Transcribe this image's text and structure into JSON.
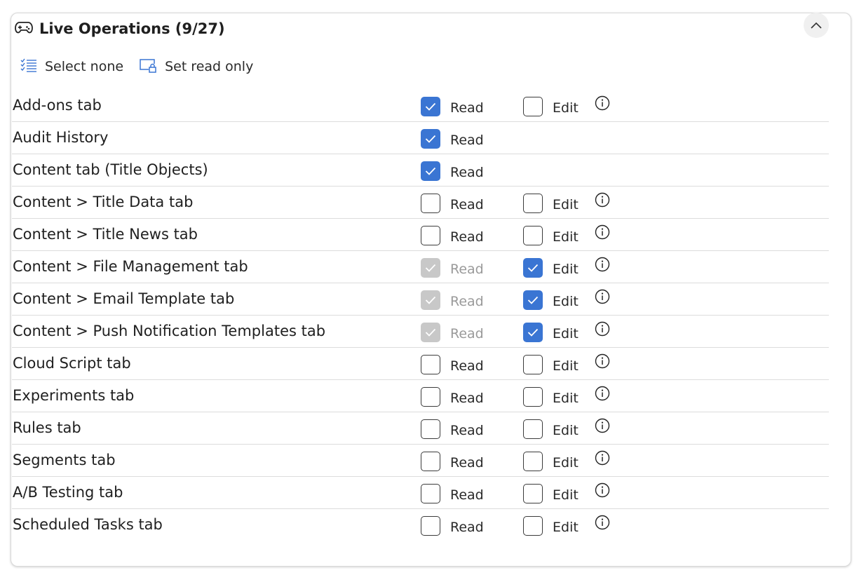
{
  "header": {
    "title": "Live Operations (9/27)",
    "icon": "gamepad-icon"
  },
  "toolbar": {
    "select_none": "Select none",
    "set_read_only": "Set read only"
  },
  "colors": {
    "accent": "#3a75d3",
    "disabled": "#c8c8c8"
  },
  "rows": [
    {
      "name": "Add-ons tab",
      "read": "checked",
      "edit": "unchecked",
      "read_label": "Read",
      "edit_label": "Edit"
    },
    {
      "name": "Audit History",
      "read": "checked",
      "edit": null,
      "read_label": "Read"
    },
    {
      "name": "Content tab (Title Objects)",
      "read": "checked",
      "edit": null,
      "read_label": "Read"
    },
    {
      "name": "Content > Title Data tab",
      "read": "unchecked",
      "edit": "unchecked",
      "read_label": "Read",
      "edit_label": "Edit"
    },
    {
      "name": "Content > Title News tab",
      "read": "unchecked",
      "edit": "unchecked",
      "read_label": "Read",
      "edit_label": "Edit"
    },
    {
      "name": "Content > File Management tab",
      "read": "disabled",
      "edit": "checked",
      "read_label": "Read",
      "edit_label": "Edit"
    },
    {
      "name": "Content > Email Template tab",
      "read": "disabled",
      "edit": "checked",
      "read_label": "Read",
      "edit_label": "Edit"
    },
    {
      "name": "Content > Push Notification Templates tab",
      "read": "disabled",
      "edit": "checked",
      "read_label": "Read",
      "edit_label": "Edit"
    },
    {
      "name": "Cloud Script tab",
      "read": "unchecked",
      "edit": "unchecked",
      "read_label": "Read",
      "edit_label": "Edit"
    },
    {
      "name": "Experiments tab",
      "read": "unchecked",
      "edit": "unchecked",
      "read_label": "Read",
      "edit_label": "Edit"
    },
    {
      "name": "Rules tab",
      "read": "unchecked",
      "edit": "unchecked",
      "read_label": "Read",
      "edit_label": "Edit"
    },
    {
      "name": "Segments tab",
      "read": "unchecked",
      "edit": "unchecked",
      "read_label": "Read",
      "edit_label": "Edit"
    },
    {
      "name": "A/B Testing tab",
      "read": "unchecked",
      "edit": "unchecked",
      "read_label": "Read",
      "edit_label": "Edit"
    },
    {
      "name": "Scheduled Tasks tab",
      "read": "unchecked",
      "edit": "unchecked",
      "read_label": "Read",
      "edit_label": "Edit"
    }
  ]
}
